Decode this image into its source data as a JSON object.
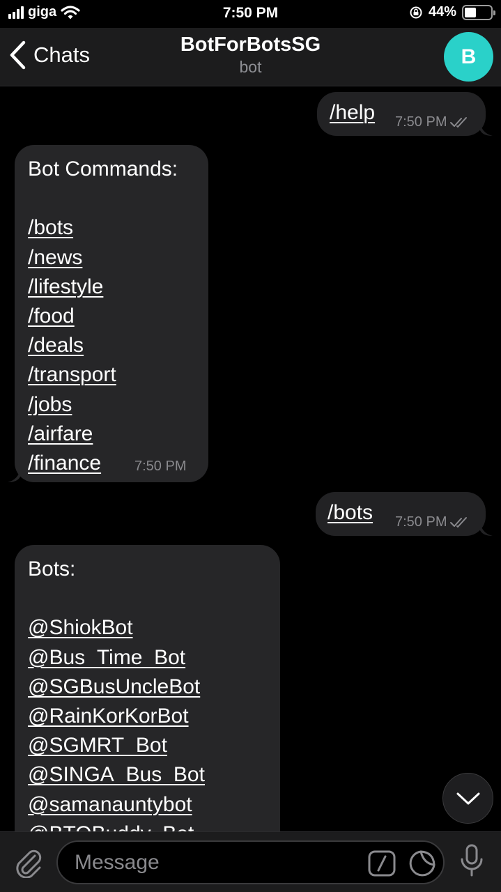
{
  "status_bar": {
    "carrier": "giga",
    "time": "7:50 PM",
    "battery_percent": "44%",
    "battery_level": 0.44,
    "icons": [
      "signal-icon",
      "wifi-icon",
      "orientation-lock-icon",
      "battery-icon"
    ]
  },
  "nav": {
    "back_label": "Chats",
    "title": "BotForBotsSG",
    "subtitle": "bot",
    "avatar_letter": "B",
    "avatar_color": "#2ad1c9"
  },
  "messages": [
    {
      "direction": "out",
      "text": "/help",
      "time": "7:50 PM",
      "read": true
    },
    {
      "direction": "in",
      "heading": "Bot Commands:",
      "commands": [
        "/bots",
        "/news",
        "/lifestyle",
        "/food",
        "/deals",
        "/transport",
        "/jobs",
        "/airfare",
        "/finance"
      ],
      "time": "7:50 PM"
    },
    {
      "direction": "out",
      "text": "/bots",
      "time": "7:50 PM",
      "read": true
    },
    {
      "direction": "in",
      "heading": "Bots:",
      "bots": [
        "@ShiokBot",
        "@Bus_Time_Bot",
        "@SGBusUncleBot",
        "@RainKorKorBot",
        "@SGMRT_Bot",
        "@SINGA_Bus_Bot",
        "@samanauntybot",
        "@BTOBuddy_Bot"
      ]
    }
  ],
  "input": {
    "placeholder": "Message"
  },
  "colors": {
    "background": "#000000",
    "bar": "#1c1c1d",
    "bubble": "#262628",
    "secondary_text": "#8a8a8e"
  }
}
